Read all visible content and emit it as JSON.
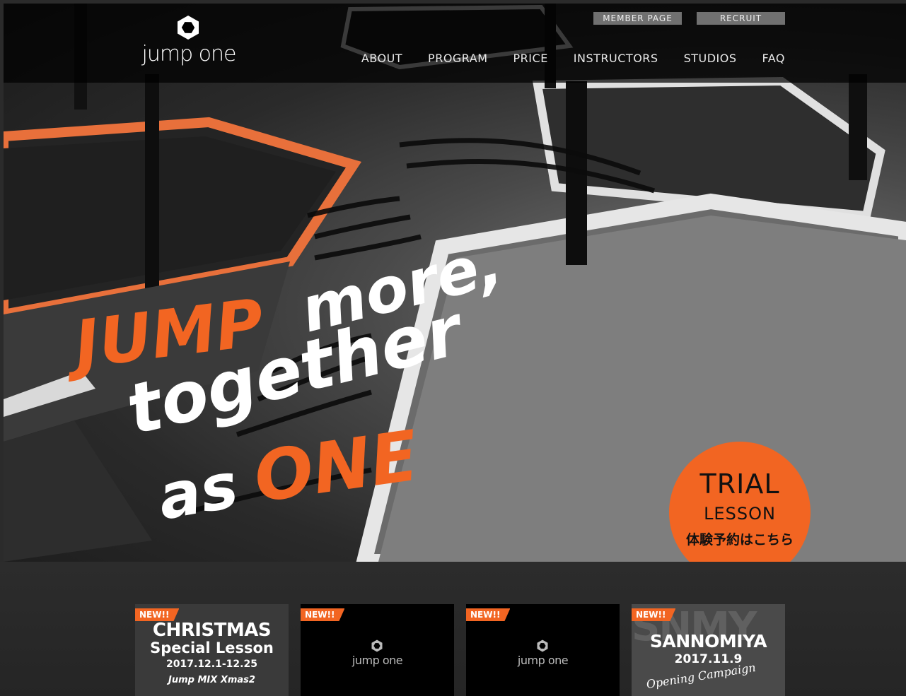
{
  "header": {
    "logo_text": "jump one",
    "util_links": {
      "member": "MEMBER PAGE",
      "recruit": "RECRUIT"
    },
    "nav": [
      "ABOUT",
      "PROGRAM",
      "PRICE",
      "INSTRUCTORS",
      "STUDIOS",
      "FAQ"
    ]
  },
  "hero": {
    "tagline": {
      "line1_a": "JUMP",
      "line1_b": "more,",
      "line2": "together",
      "line3_a": "as",
      "line3_b": "ONE"
    },
    "trial": {
      "line1": "TRIAL",
      "line2": "LESSON",
      "line3": "体験予約はこちら"
    }
  },
  "news": {
    "badge": "NEW!!",
    "cards": [
      {
        "title": "CHRISTMAS",
        "subtitle": "Special Lesson",
        "dates": "2017.12.1-12.25",
        "note": "Jump MIX Xmas2"
      },
      {
        "logo_text": "jump one"
      },
      {
        "logo_text": "jump one"
      },
      {
        "bg_text": "SNMY",
        "title": "SANNOMIYA",
        "date": "2017.11.9",
        "note": "Opening Campaign"
      }
    ]
  },
  "colors": {
    "accent": "#f26522",
    "header_bg": "#000000",
    "util_btn": "#707070"
  }
}
